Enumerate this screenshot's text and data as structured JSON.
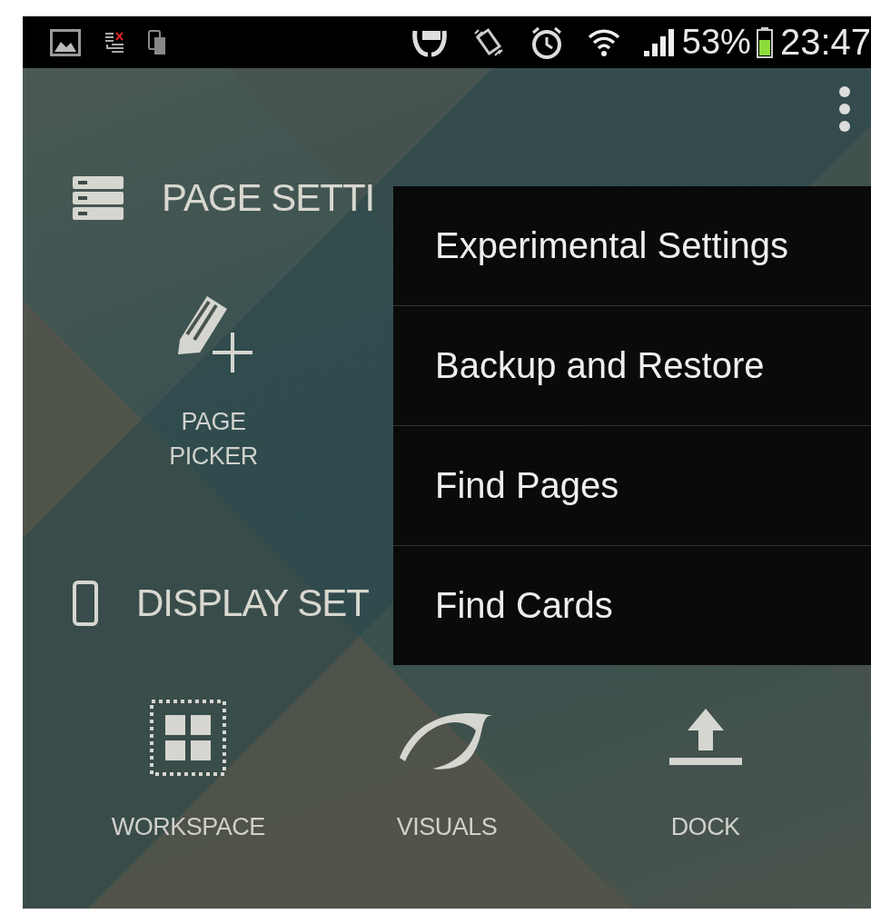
{
  "status_bar": {
    "battery_text": "53%",
    "time": "23:47"
  },
  "sections": [
    {
      "title": "PAGE SETTI",
      "kind": "page",
      "items": [
        {
          "label": "PAGE PICKER",
          "kind": "pencil"
        }
      ]
    },
    {
      "title": "DISPLAY SET",
      "kind": "display",
      "items": [
        {
          "label": "WORKSPACE",
          "kind": "workspace"
        },
        {
          "label": "VISUALS",
          "kind": "visuals"
        },
        {
          "label": "DOCK",
          "kind": "dock"
        }
      ]
    }
  ],
  "menu": {
    "items": [
      "Experimental Settings",
      "Backup and Restore",
      "Find Pages",
      "Find Cards"
    ]
  }
}
